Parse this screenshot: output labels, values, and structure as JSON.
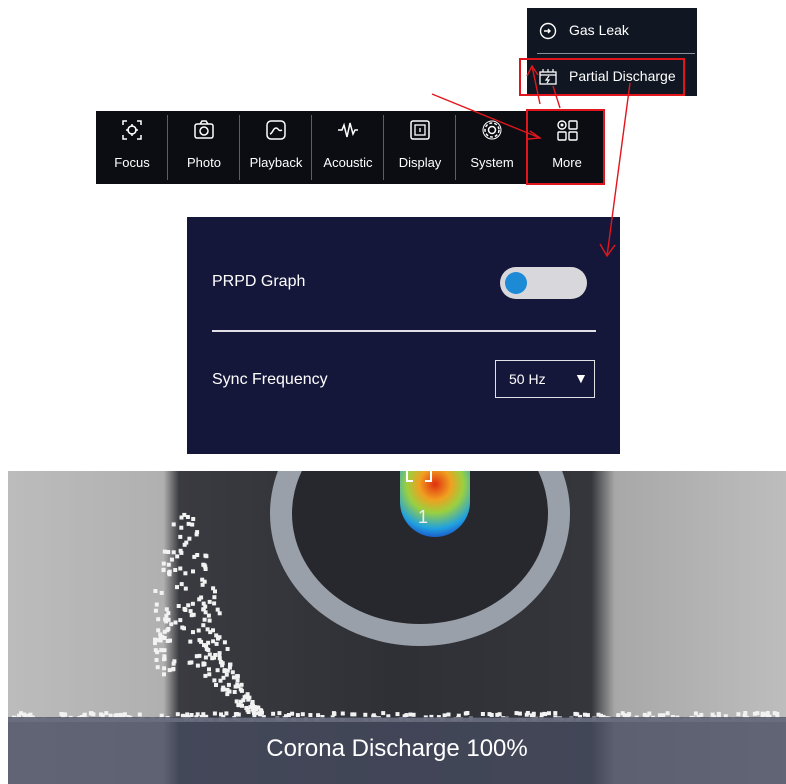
{
  "more_menu": {
    "items": [
      {
        "label": "Gas Leak",
        "icon": "gas-leak-icon"
      },
      {
        "label": "Partial Discharge",
        "icon": "partial-discharge-icon"
      }
    ]
  },
  "toolbar": {
    "buttons": [
      {
        "label": "Focus",
        "icon": "focus-icon"
      },
      {
        "label": "Photo",
        "icon": "camera-icon"
      },
      {
        "label": "Playback",
        "icon": "playback-icon"
      },
      {
        "label": "Acoustic",
        "icon": "waveform-icon"
      },
      {
        "label": "Display",
        "icon": "display-icon"
      },
      {
        "label": "System",
        "icon": "gear-icon"
      },
      {
        "label": "More",
        "icon": "grid-icon"
      }
    ]
  },
  "pd_settings": {
    "prpd_label": "PRPD Graph",
    "prpd_enabled": false,
    "sync_label": "Sync Frequency",
    "sync_value": "50 Hz"
  },
  "camera": {
    "target_number": "1",
    "status_text": "Corona Discharge 100%"
  },
  "colors": {
    "annotation": "#e0161c",
    "panel_bg": "#15173a",
    "toggle_knob": "#1d8ad6"
  }
}
